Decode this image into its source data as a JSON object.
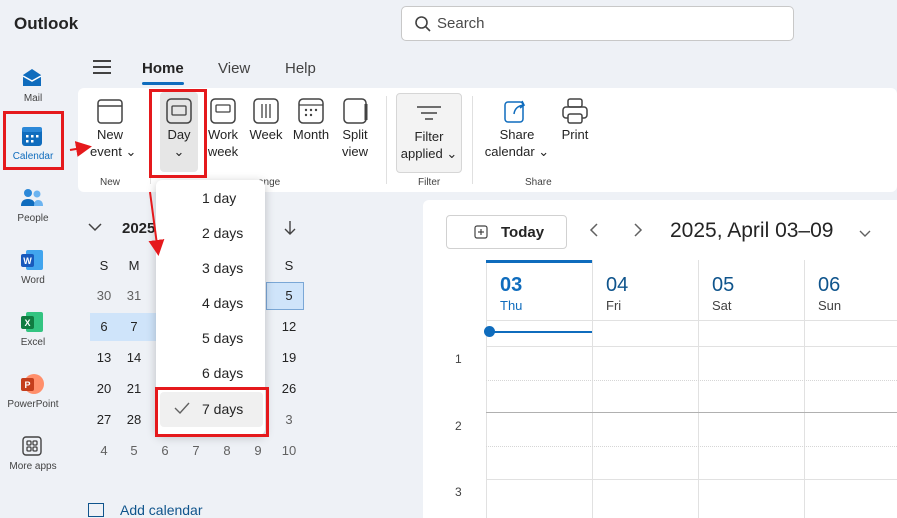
{
  "app": {
    "title": "Outlook"
  },
  "search": {
    "placeholder": "Search"
  },
  "rail": {
    "items": [
      {
        "label": "Mail",
        "icon": "mail-icon"
      },
      {
        "label": "Calendar",
        "icon": "calendar-icon"
      },
      {
        "label": "People",
        "icon": "people-icon"
      },
      {
        "label": "Word",
        "icon": "word-icon"
      },
      {
        "label": "Excel",
        "icon": "excel-icon"
      },
      {
        "label": "PowerPoint",
        "icon": "powerpoint-icon"
      },
      {
        "label": "More apps",
        "icon": "more-apps-icon"
      }
    ]
  },
  "ribbon": {
    "tabs": [
      "Home",
      "View",
      "Help"
    ],
    "new_event": {
      "line1": "New",
      "line2": "event"
    },
    "day": {
      "line1": "Day"
    },
    "work_week": {
      "line1": "Work",
      "line2": "week"
    },
    "week": {
      "line1": "Week"
    },
    "month": {
      "line1": "Month"
    },
    "split_view": {
      "line1": "Split",
      "line2": "view"
    },
    "filter": {
      "line1": "Filter",
      "line2": "applied"
    },
    "share_calendar": {
      "line1": "Share",
      "line2": "calendar"
    },
    "print": {
      "line1": "Print"
    },
    "groups": {
      "new": "New",
      "arrange": "ange",
      "filter": "Filter",
      "share": "Share"
    }
  },
  "day_dropdown": {
    "options": [
      "1 day",
      "2 days",
      "3 days",
      "4 days",
      "5 days",
      "6 days",
      "7 days"
    ],
    "selected": "7 days"
  },
  "mini_calendar": {
    "title": "2025",
    "weekday_headers": [
      "S",
      "M",
      "",
      "",
      "",
      "",
      "S"
    ],
    "rows": [
      [
        "30",
        "31",
        "",
        "",
        "",
        "",
        "5"
      ],
      [
        "6",
        "7",
        "",
        "",
        "",
        "",
        "12"
      ],
      [
        "13",
        "14",
        "",
        "",
        "",
        "",
        "19"
      ],
      [
        "20",
        "21",
        "",
        "",
        "",
        "",
        "26"
      ],
      [
        "27",
        "28",
        "",
        "",
        "",
        "",
        "3"
      ],
      [
        "4",
        "5",
        "6",
        "7",
        "8",
        "9",
        "10"
      ]
    ],
    "add_calendar": "Add calendar"
  },
  "calendar": {
    "today_label": "Today",
    "range_label": "2025, April 03–09",
    "columns": [
      {
        "date": "03",
        "weekday": "Thu"
      },
      {
        "date": "04",
        "weekday": "Fri"
      },
      {
        "date": "05",
        "weekday": "Sat"
      },
      {
        "date": "06",
        "weekday": "Sun"
      }
    ],
    "hours": [
      "1",
      "2",
      "3"
    ]
  },
  "colors": {
    "accent": "#0f6cbd",
    "highlight": "#e5191c",
    "selection": "#cfe4fa"
  }
}
